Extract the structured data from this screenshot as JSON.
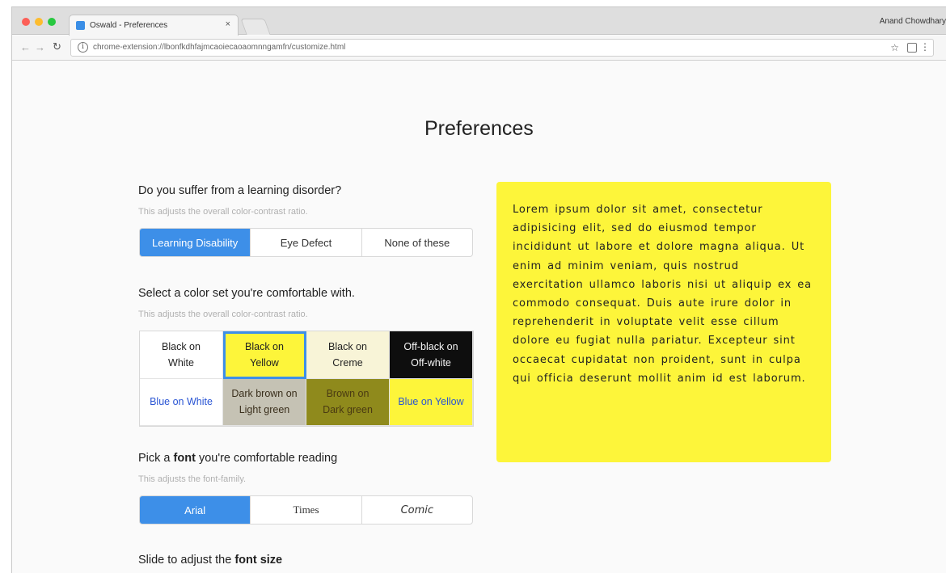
{
  "browser": {
    "tab_title": "Oswald - Preferences",
    "tab_close": "×",
    "user_name": "Anand Chowdhary",
    "url": "chrome-extension://lbonfkdhfajmcaoiecaoaomnngamfn/customize.html",
    "icons": [
      "back-arrow-icon",
      "forward-arrow-icon",
      "reload-icon",
      "info-icon",
      "star-icon",
      "extension-icon",
      "menu-icon"
    ]
  },
  "page": {
    "title": "Preferences"
  },
  "q1": {
    "title": "Do you suffer from a learning disorder?",
    "subtitle": "This adjusts the overall color-contrast ratio.",
    "options": [
      {
        "label": "Learning Disability",
        "selected": true
      },
      {
        "label": "Eye Defect",
        "selected": false
      },
      {
        "label": "None of these",
        "selected": false
      }
    ]
  },
  "q2": {
    "title": "Select a color set you're comfortable with.",
    "subtitle": "This adjusts the overall color-contrast ratio.",
    "options": [
      {
        "line1": "Black on",
        "line2": "White",
        "bg": "#ffffff",
        "fg": "#222222",
        "selected": false
      },
      {
        "line1": "Black on",
        "line2": "Yellow",
        "bg": "#fdf53a",
        "fg": "#222222",
        "selected": true
      },
      {
        "line1": "Black on",
        "line2": "Creme",
        "bg": "#f8f4d7",
        "fg": "#222222",
        "selected": false
      },
      {
        "line1": "Off-black on",
        "line2": "Off-white",
        "bg": "#0e0e0e",
        "fg": "#f5f5f5",
        "selected": false
      },
      {
        "label": "Blue on White",
        "bg": "#ffffff",
        "fg": "#2a55d4",
        "selected": false
      },
      {
        "line1": "Dark brown on",
        "line2": "Light green",
        "bg": "#c5c2b4",
        "fg": "#3a2f1c",
        "selected": false
      },
      {
        "line1": "Brown on",
        "line2": "Dark green",
        "bg": "#8f8a1c",
        "fg": "#4a3a12",
        "selected": false
      },
      {
        "label": "Blue on Yellow",
        "bg": "#fdf53a",
        "fg": "#2a55d4",
        "selected": false
      }
    ]
  },
  "q3": {
    "title_pre": "Pick a",
    "title_bold": "font",
    "title_post": "you're comfortable reading",
    "subtitle": "This adjusts the font-family.",
    "options": [
      {
        "label": "Arial",
        "selected": true
      },
      {
        "label": "Times",
        "selected": false
      },
      {
        "label": "Comic",
        "selected": false
      }
    ]
  },
  "q4": {
    "title_pre": "Slide to adjust the",
    "title_bold": "font size"
  },
  "preview": {
    "text": "Lorem ipsum dolor sit amet, consectetur adipisicing elit, sed do eiusmod tempor incididunt ut labore et dolore magna aliqua. Ut enim ad minim veniam, quis nostrud exercitation ullamco laboris nisi ut aliquip ex ea commodo consequat. Duis aute irure dolor in reprehenderit in voluptate velit esse cillum dolore eu fugiat nulla pariatur. Excepteur sint occaecat cupidatat non proident, sunt in culpa qui officia deserunt mollit anim id est laborum.",
    "bg": "#fdf53a"
  },
  "colors": {
    "accent": "#3d8fe8",
    "muted_text": "#b0b0b0"
  }
}
